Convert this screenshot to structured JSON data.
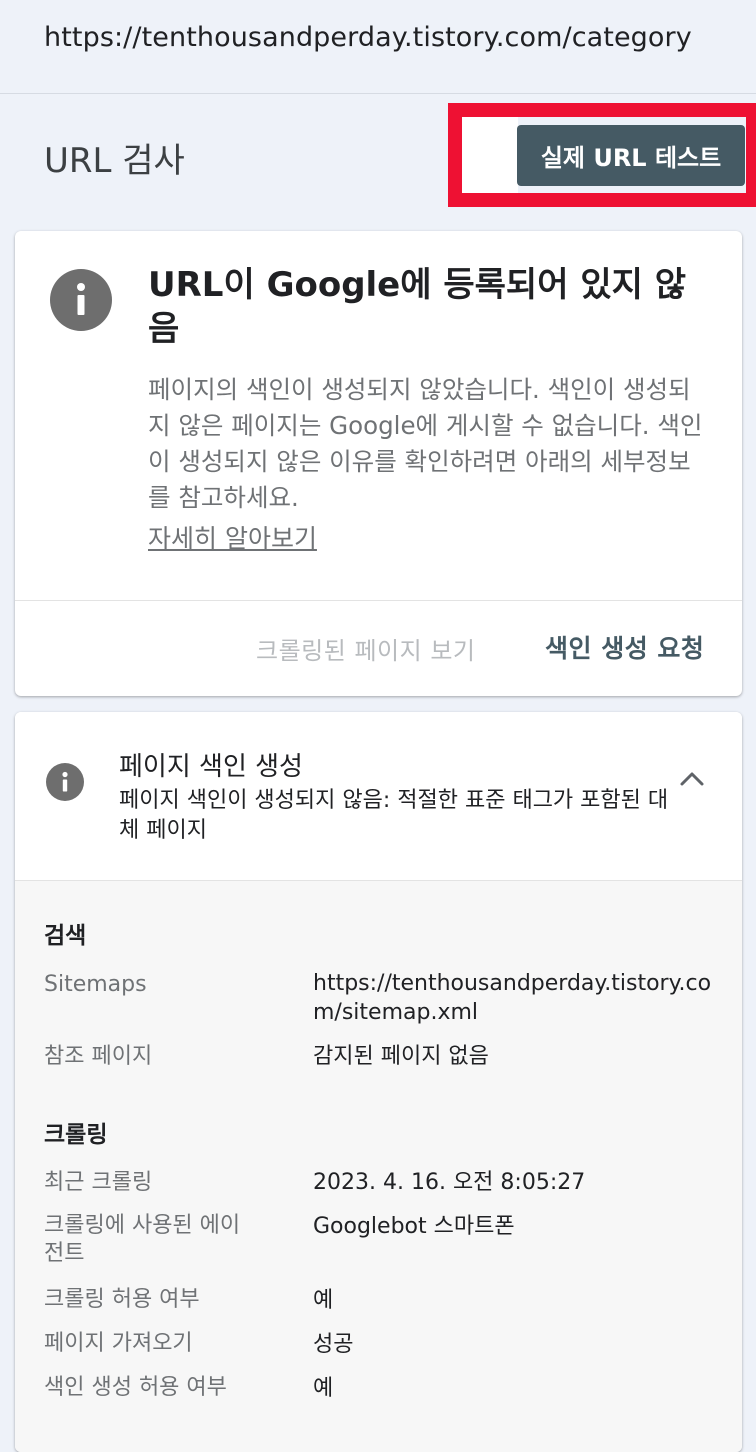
{
  "browser": {
    "url": "https://tenthousandperday.tistory.com/category"
  },
  "header": {
    "title": "URL 검사",
    "test_button_label": "실제 URL 테스트"
  },
  "status_card": {
    "title": "URL이 Google에 등록되어 있지 않음",
    "description": "페이지의 색인이 생성되지 않았습니다. 색인이 생성되지 않은 페이지는 Google에 게시할 수 없습니다. 색인이 생성되지 않은 이유를 확인하려면 아래의 세부정보를 참고하세요.",
    "learn_more": "자세히 알아보기",
    "view_crawled_label": "크롤링된 페이지 보기",
    "request_indexing_label": "색인 생성 요청",
    "icon": "info-icon"
  },
  "indexing_card": {
    "title": "페이지 색인 생성",
    "subtitle": "페이지 색인이 생성되지 않음: 적절한 표준 태그가 포함된 대체 페이지",
    "icon": "info-icon",
    "toggle_icon": "chevron-up-icon",
    "discovery": {
      "heading": "검색",
      "rows": [
        {
          "label": "Sitemaps",
          "value": "https://tenthousandperday.tistory.com/sitemap.xml"
        },
        {
          "label": "참조 페이지",
          "value": "감지된 페이지 없음"
        }
      ]
    },
    "crawl": {
      "heading": "크롤링",
      "rows": [
        {
          "label": "최근 크롤링",
          "value": "2023. 4. 16. 오전 8:05:27"
        },
        {
          "label": "크롤링에 사용된 에이전트",
          "value": "Googlebot 스마트폰"
        },
        {
          "label": "크롤링 허용 여부",
          "value": "예"
        },
        {
          "label": "페이지 가져오기",
          "value": "성공"
        },
        {
          "label": "색인 생성 허용 여부",
          "value": "예"
        }
      ]
    }
  },
  "colors": {
    "accent_button": "#455a64",
    "highlight": "#ee1133",
    "background": "#eef2f9"
  }
}
